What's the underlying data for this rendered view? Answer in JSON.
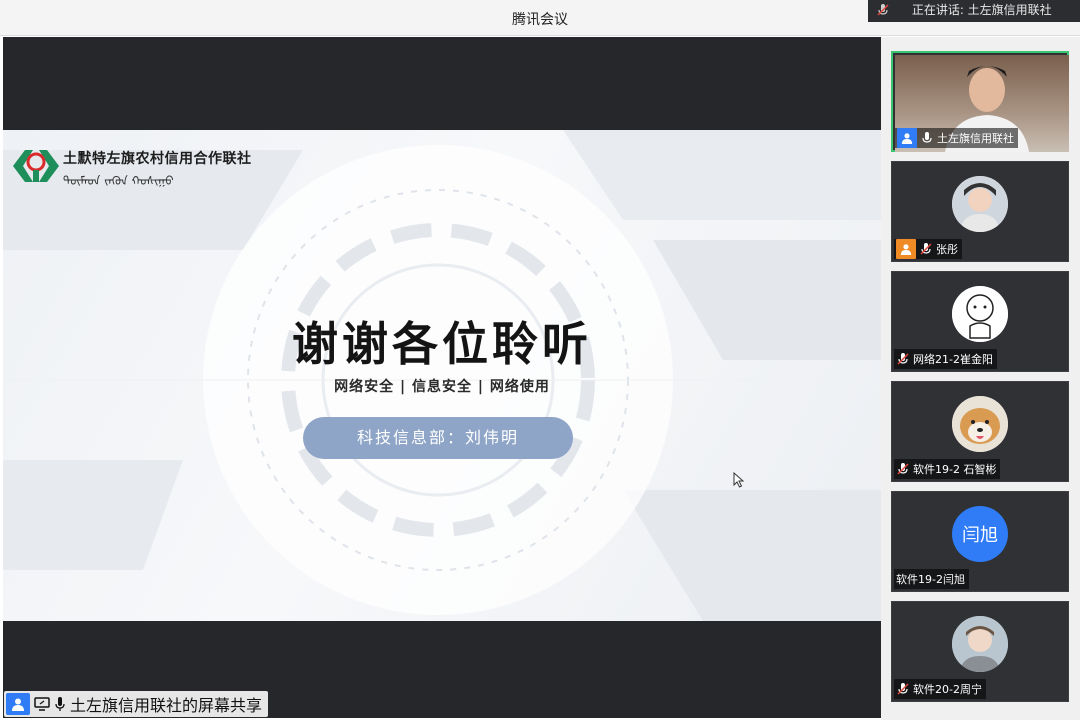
{
  "window": {
    "title": "腾讯会议"
  },
  "speaking": {
    "text": "正在讲话: 土左旗信用联社"
  },
  "slide": {
    "org_name": "土默特左旗农村信用合作联社",
    "org_mongolian": "ᠲᠦᠮᠡᠳ ᠵᠡᠭᠦᠨ ᠬᠣᠰᠢᠭᠤ",
    "heading": "谢谢各位聆听",
    "tagline": "网络安全 | 信息安全 | 网络使用",
    "presenter": "科技信息部：刘伟明"
  },
  "share_label": {
    "text": "土左旗信用联社的屏幕共享"
  },
  "participants": [
    {
      "name": "土左旗信用联社",
      "avatar": "video",
      "mic": "on",
      "badge_color": "#2f7cf6",
      "active": true
    },
    {
      "name": "张彤",
      "avatar": "photo",
      "mic": "muted",
      "badge_color": "#f08a24"
    },
    {
      "name": "网络21-2崔金阳",
      "avatar": "photo",
      "mic": "muted"
    },
    {
      "name": "软件19-2 石智彬",
      "avatar": "photo",
      "mic": "muted"
    },
    {
      "name": "软件19-2闫旭",
      "avatar": "initials",
      "initials": "闫旭",
      "mic": "none"
    },
    {
      "name": "软件20-2周宁",
      "avatar": "photo",
      "mic": "muted"
    }
  ],
  "colors": {
    "accent": "#2f7cf6",
    "active_border": "#3cc46e",
    "pill": "#8ea5c8"
  }
}
